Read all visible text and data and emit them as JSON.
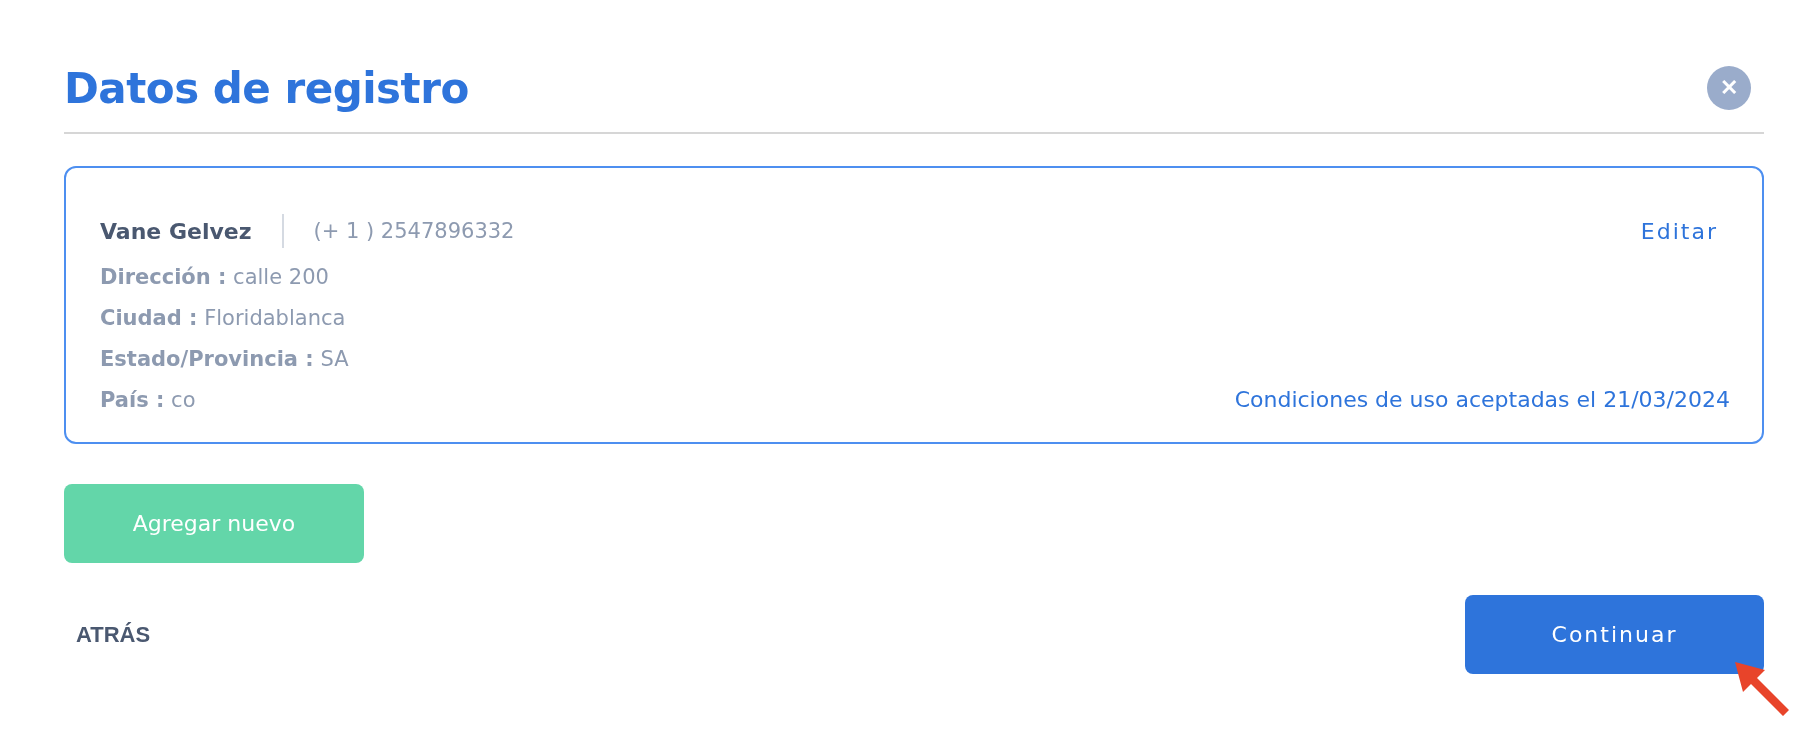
{
  "dialog": {
    "title": "Datos de registro",
    "close_label": "✕"
  },
  "record": {
    "name": "Vane Gelvez",
    "phone": "(+ 1 ) 2547896332",
    "edit_link": "Editar",
    "fields": [
      {
        "label": "Dirección :",
        "value": "calle 200"
      },
      {
        "label": "Ciudad :",
        "value": "Floridablanca"
      },
      {
        "label": "Estado/Provincia :",
        "value": "SA"
      },
      {
        "label": "País :",
        "value": "co"
      }
    ],
    "terms_note": "Condiciones de uso aceptadas el 21/03/2024"
  },
  "add_button": "Agregar nuevo",
  "back_button": "ATRÁS",
  "continue_button": "Continuar"
}
